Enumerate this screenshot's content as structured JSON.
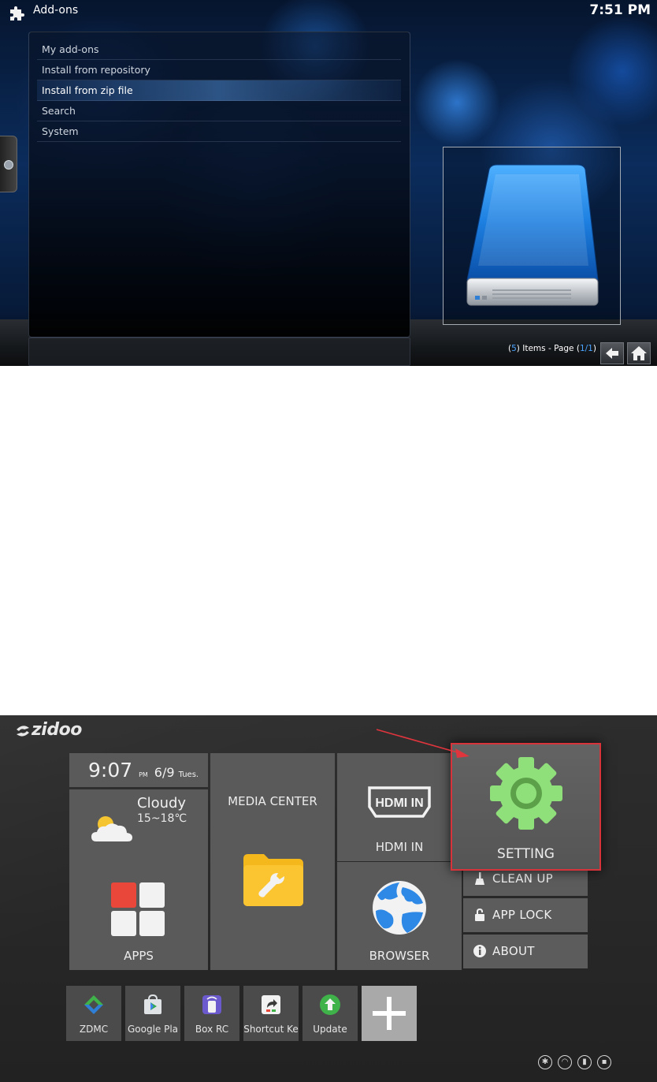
{
  "kodi": {
    "title": "Add-ons",
    "clock": "7:51 PM",
    "menu": [
      {
        "label": "My add-ons"
      },
      {
        "label": "Install from repository"
      },
      {
        "label": "Install from zip file"
      },
      {
        "label": "Search"
      },
      {
        "label": "System"
      }
    ],
    "focused_index": 2,
    "items_count": "5",
    "items_text": " Items - Page ",
    "page": "1/1",
    "colors": {
      "accent": "#4aa3ff",
      "background": "#0b2c5c"
    },
    "icons": {
      "header": "addons-puzzle-icon",
      "thumbnail": "hard-drive-icon",
      "back": "back-arrow-icon",
      "home": "home-icon"
    }
  },
  "zidoo": {
    "logo": "zidoo",
    "time": {
      "hour": "9:07",
      "ampm": "PM",
      "date": "6/9",
      "weekday": "Tues."
    },
    "weather": {
      "condition": "Cloudy",
      "temperature": "15~18℃"
    },
    "tiles": {
      "media_center": "MEDIA CENTER",
      "hdmi_in": "HDMI IN",
      "hdmi_badge": "HDMI IN",
      "setting": "SETTING",
      "apps": "APPS",
      "browser": "BROWSER"
    },
    "side_menu": [
      {
        "label": "CLEAN UP"
      },
      {
        "label": "APP LOCK"
      },
      {
        "label": "ABOUT"
      }
    ],
    "apps": [
      {
        "label": "ZDMC"
      },
      {
        "label": "Google Pla"
      },
      {
        "label": "Box RC"
      },
      {
        "label": "Shortcut Ke"
      },
      {
        "label": "Update"
      }
    ],
    "colors": {
      "highlight_border": "#d6333a",
      "setting_gear": "#8fe07a",
      "apps_red": "#e8473a"
    },
    "status_icons": [
      "bluetooth-icon",
      "wifi-icon",
      "usb-icon",
      "ethernet-icon"
    ]
  }
}
